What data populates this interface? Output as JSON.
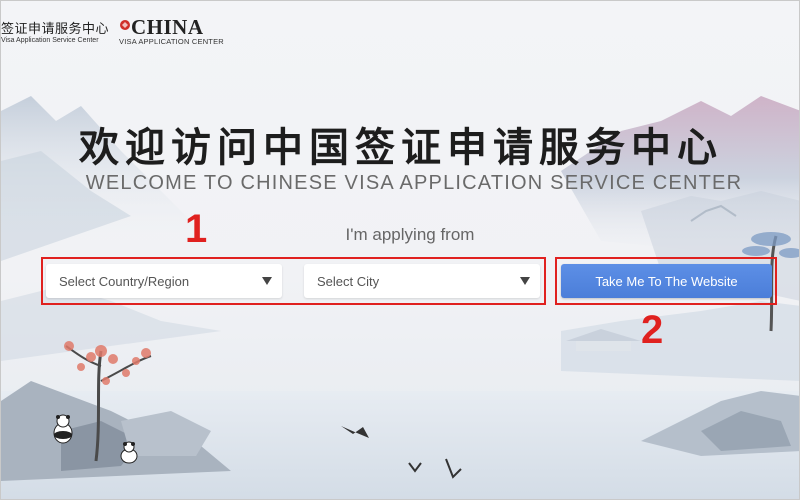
{
  "header": {
    "logo_cn": "签证申请服务中心",
    "logo_en": "Visa Application Service Center",
    "china_word": "CHINA",
    "china_sub": "VISA APPLICATION CENTER"
  },
  "hero": {
    "title_cn": "欢迎访问中国签证申请服务中心",
    "title_en": "WELCOME TO CHINESE VISA APPLICATION SERVICE CENTER",
    "applying_label": "I'm applying from"
  },
  "form": {
    "country_placeholder": "Select Country/Region",
    "city_placeholder": "Select City",
    "go_button": "Take Me To The Website"
  },
  "annotations": {
    "label_1": "1",
    "label_2": "2"
  },
  "colors": {
    "annotation_red": "#e0211f",
    "button_blue": "#4b7ed9"
  }
}
